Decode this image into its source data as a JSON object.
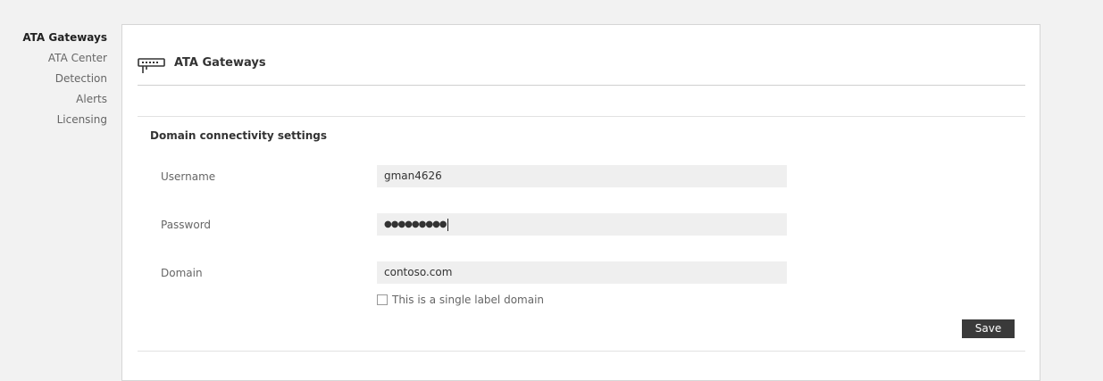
{
  "nav": {
    "items": [
      {
        "label": "ATA Gateways",
        "active": true
      },
      {
        "label": "ATA Center"
      },
      {
        "label": "Detection"
      },
      {
        "label": "Alerts"
      },
      {
        "label": "Licensing"
      }
    ]
  },
  "header": {
    "icon": "gateway-icon",
    "title": "ATA Gateways"
  },
  "section": {
    "title": "Domain connectivity settings",
    "fields": {
      "username": {
        "label": "Username",
        "value": "gman4626"
      },
      "password": {
        "label": "Password",
        "masked_value": "●●●●●●●●●"
      },
      "domain": {
        "label": "Domain",
        "value": "contoso.com"
      }
    },
    "single_label_checkbox": {
      "label": "This is a single label domain",
      "checked": false
    },
    "save_label": "Save"
  },
  "colors": {
    "page_background": "#f2f2f2",
    "panel_background": "#ffffff",
    "input_background": "#efefef",
    "button_background": "#3a3a3a"
  }
}
